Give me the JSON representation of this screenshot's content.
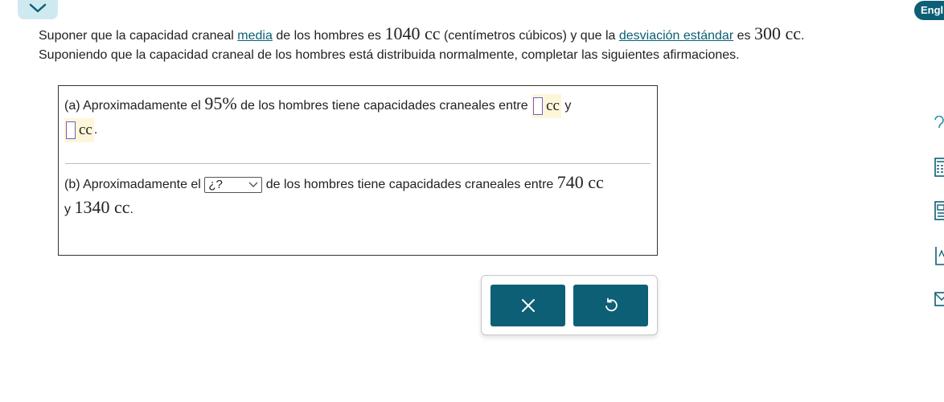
{
  "header": {
    "language_label": "English"
  },
  "intro": {
    "line1": {
      "p1": "Suponer que la capacidad craneal ",
      "link1": "media",
      "p2": " de los hombres es ",
      "mean_value": "1040 cc",
      "p3": " (centímetros cúbicos) y que la ",
      "link2": "desviación estándar",
      "p4": " es ",
      "sd_value": "300 cc",
      "p5": "."
    },
    "line2": "Suponiendo que la capacidad craneal de los hombres está distribuida normalmente, completar las siguientes afirmaciones."
  },
  "part_a": {
    "p1": "(a) Aproximadamente el ",
    "percent": "95%",
    "p2": " de los hombres tiene capacidades craneales entre ",
    "unit1": "cc",
    "p3": " y",
    "unit2": "cc",
    "p4": "."
  },
  "part_b": {
    "p1": "(b) Aproximadamente el ",
    "select_value": "¿?",
    "p2": " de los hombres tiene capacidades craneales entre ",
    "low": "740 cc",
    "p3": "y ",
    "high": "1340 cc",
    "p4": "."
  },
  "actions": {
    "clear_icon": "x-icon",
    "undo_icon": "undo-icon"
  },
  "colors": {
    "accent": "#0c5f75",
    "tab": "#cfe9f1",
    "answer_bg": "#fdf6d8",
    "answer_border": "#7a5cc7"
  }
}
